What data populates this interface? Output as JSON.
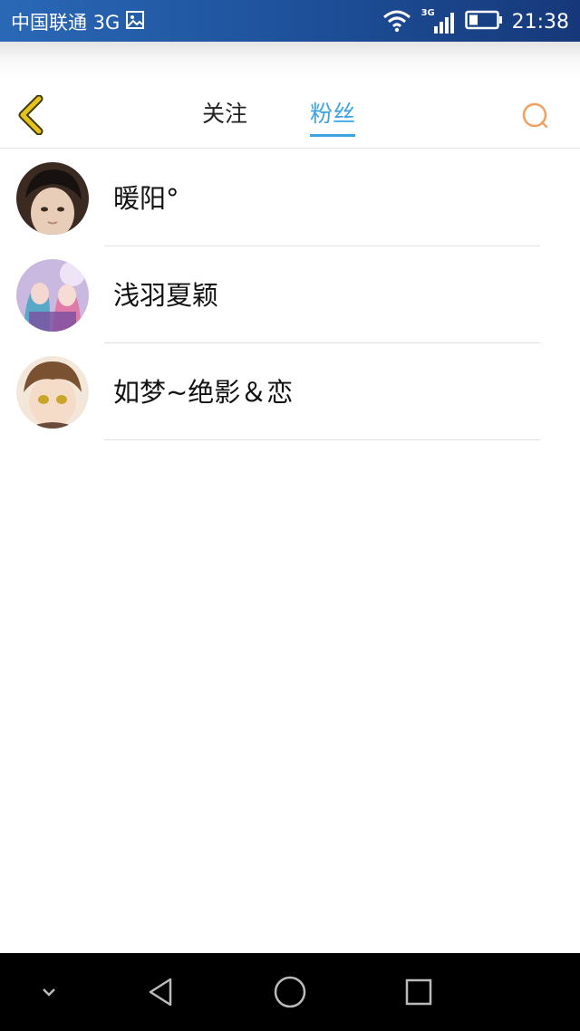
{
  "status_bar": {
    "carrier": "中国联通 3G",
    "network_badge": "3G",
    "time": "21:38",
    "icons": [
      "image-icon",
      "wifi-icon",
      "signal-icon",
      "battery-icon"
    ]
  },
  "header": {
    "back_icon": "chevron-left-icon",
    "tabs": [
      {
        "label": "关注",
        "active": false
      },
      {
        "label": "粉丝",
        "active": true
      }
    ],
    "search_icon": "search-icon"
  },
  "colors": {
    "accent": "#3aa3e0",
    "back_icon": "#e8c21c",
    "search_icon": "#f0a060",
    "status_bar": "#1d4f98"
  },
  "fans": [
    {
      "name": "暖阳°"
    },
    {
      "name": "浅羽夏颖"
    },
    {
      "name": "如梦~绝影＆恋"
    }
  ],
  "nav_bar": {
    "icons": [
      "chevron-down-icon",
      "back-triangle-icon",
      "home-circle-icon",
      "recents-square-icon"
    ]
  }
}
